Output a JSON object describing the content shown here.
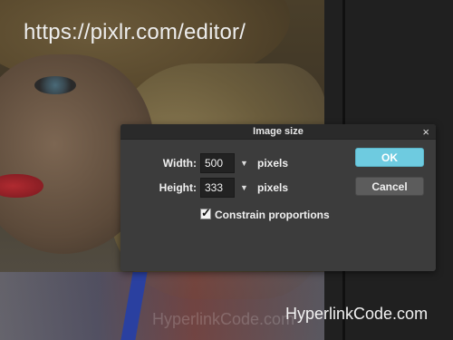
{
  "overlay": {
    "url_text": "https://pixlr.com/editor/",
    "watermark": "HyperlinkCode.com",
    "watermark_faint": "HyperlinkCode.com"
  },
  "dialog": {
    "title": "Image size",
    "close_icon": "close-icon",
    "width_label": "Width:",
    "width_value": "500",
    "height_label": "Height:",
    "height_value": "333",
    "unit_label": "pixels",
    "constrain_label": "Constrain proportions",
    "constrain_checked": true,
    "ok_label": "OK",
    "cancel_label": "Cancel"
  },
  "colors": {
    "ok_button": "#6ecbe0",
    "dialog_bg": "#3c3c3c",
    "panel_bg": "#202020"
  }
}
